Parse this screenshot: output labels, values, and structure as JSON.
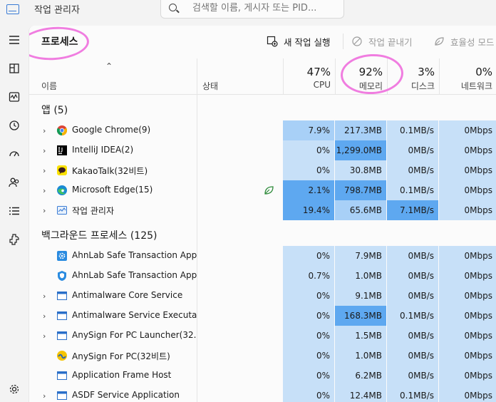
{
  "window": {
    "title": "작업 관리자"
  },
  "search": {
    "placeholder": "검색할 이름, 게시자 또는 PID..."
  },
  "page": {
    "title": "프로세스"
  },
  "toolbar": {
    "run_new_task": "새 작업 실행",
    "end_task": "작업 끝내기",
    "efficiency_mode": "효율성 모드"
  },
  "columns": {
    "name": "이름",
    "status": "상태",
    "cpu": {
      "pct": "47%",
      "label": "CPU"
    },
    "memory": {
      "pct": "92%",
      "label": "메모리"
    },
    "disk": {
      "pct": "3%",
      "label": "디스크"
    },
    "network": {
      "pct": "0%",
      "label": "네트워크"
    }
  },
  "groups": {
    "apps": "앱 (5)",
    "background": "백그라운드 프로세스 (125)"
  },
  "apps": [
    {
      "name": "Google Chrome(9)",
      "icon": "chrome-icon",
      "cpu": "7.9%",
      "mem": "217.3MB",
      "disk": "0.1MB/s",
      "net": "0Mbps"
    },
    {
      "name": "IntelliJ IDEA(2)",
      "icon": "intellij-icon",
      "cpu": "0%",
      "mem": "1,299.0MB",
      "disk": "0MB/s",
      "net": "0Mbps"
    },
    {
      "name": "KakaoTalk(32비트)",
      "icon": "kakaotalk-icon",
      "cpu": "0%",
      "mem": "30.8MB",
      "disk": "0MB/s",
      "net": "0Mbps"
    },
    {
      "name": "Microsoft Edge(15)",
      "icon": "edge-icon",
      "cpu": "2.1%",
      "mem": "798.7MB",
      "disk": "0.1MB/s",
      "net": "0Mbps",
      "status_icon": "leaf-icon"
    },
    {
      "name": "작업 관리자",
      "icon": "task-manager-icon",
      "cpu": "19.4%",
      "mem": "65.6MB",
      "disk": "7.1MB/s",
      "net": "0Mbps"
    }
  ],
  "background": [
    {
      "name": "AhnLab Safe Transaction App...",
      "icon": "gear-blue-icon",
      "cpu": "0%",
      "mem": "7.9MB",
      "disk": "0MB/s",
      "net": "0Mbps"
    },
    {
      "name": "AhnLab Safe Transaction App...",
      "icon": "shield-blue-icon",
      "cpu": "0.7%",
      "mem": "1.0MB",
      "disk": "0MB/s",
      "net": "0Mbps"
    },
    {
      "name": "Antimalware Core Service",
      "icon": "window-icon",
      "cpu": "0%",
      "mem": "9.1MB",
      "disk": "0MB/s",
      "net": "0Mbps"
    },
    {
      "name": "Antimalware Service Executa...",
      "icon": "window-icon",
      "cpu": "0%",
      "mem": "168.3MB",
      "disk": "0.1MB/s",
      "net": "0Mbps"
    },
    {
      "name": "AnySign For PC Launcher(32...",
      "icon": "window-icon",
      "cpu": "0%",
      "mem": "1.5MB",
      "disk": "0MB/s",
      "net": "0Mbps"
    },
    {
      "name": "AnySign For PC(32비트)",
      "icon": "anysign-icon",
      "cpu": "0%",
      "mem": "1.0MB",
      "disk": "0MB/s",
      "net": "0Mbps"
    },
    {
      "name": "Application Frame Host",
      "icon": "window-icon",
      "cpu": "0%",
      "mem": "6.2MB",
      "disk": "0MB/s",
      "net": "0Mbps"
    },
    {
      "name": "ASDF Service Application",
      "icon": "window-icon",
      "cpu": "0%",
      "mem": "12.4MB",
      "disk": "0.1MB/s",
      "net": "0Mbps"
    }
  ]
}
